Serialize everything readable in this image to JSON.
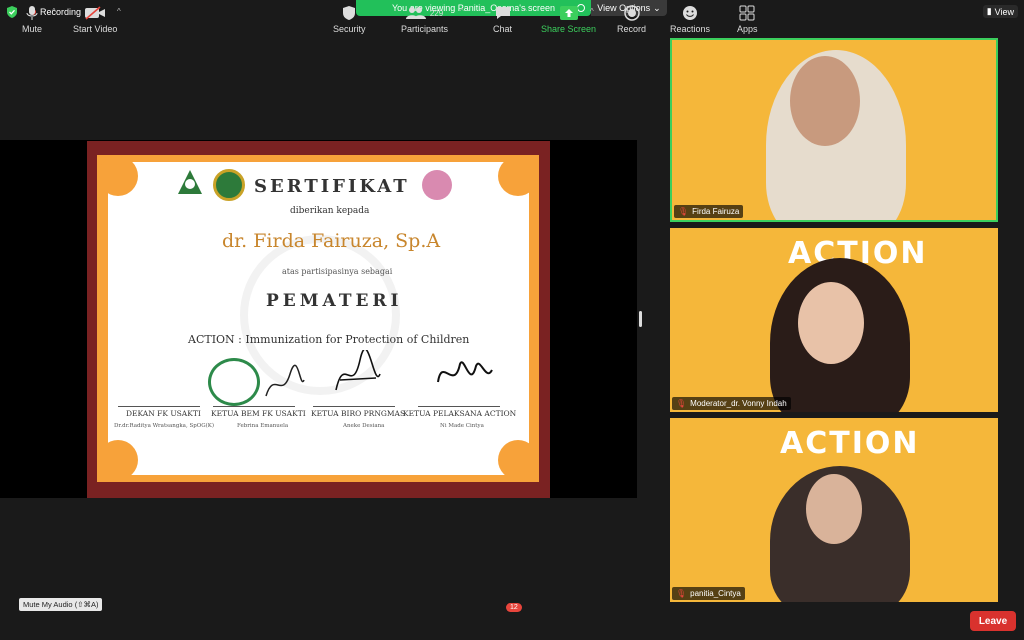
{
  "top": {
    "recording_label": "Recording",
    "viewing_text": "You are viewing Panitia_Osama's screen",
    "view_options_label": "View Options",
    "view_label": "View"
  },
  "certificate": {
    "title": "SERTIFIKAT",
    "given_to": "diberikan kepada",
    "recipient": "dr. Firda Fairuza, Sp.A",
    "participation": "atas partisipasinya sebagai",
    "role": "PEMATERI",
    "event": "ACTION : Immunization for Protection of Children",
    "signatories": [
      {
        "title": "DEKAN FK USAKTI",
        "name": "Dr.dr.Raditya Wratsangka, SpOG(K)"
      },
      {
        "title": "KETUA BEM FK USAKTI",
        "name": "Febrina Emanuela"
      },
      {
        "title": "KETUA BIRO PRNGMAS",
        "name": "Aneke Desiana"
      },
      {
        "title": "KETUA PELAKSANA ACTION",
        "name": "Ni Made Cintya"
      }
    ],
    "accent_color": "#f7a23a",
    "frame_color": "#7a2222"
  },
  "participants": [
    {
      "name": "Firda Fairuza",
      "active_speaker": true
    },
    {
      "name": "Moderator_dr. Vonny Indah",
      "active_speaker": false
    },
    {
      "name": "panitia_Cintya",
      "active_speaker": false
    }
  ],
  "tile_banner": "ACTION",
  "toolbar": {
    "tooltip": "Mute My Audio (⇧⌘A)",
    "mute": "Mute",
    "start_video": "Start Video",
    "security": "Security",
    "participants": "Participants",
    "participants_count": "229",
    "chat": "Chat",
    "chat_badge": "12",
    "share_screen": "Share Screen",
    "record": "Record",
    "reactions": "Reactions",
    "apps": "Apps",
    "leave": "Leave"
  }
}
